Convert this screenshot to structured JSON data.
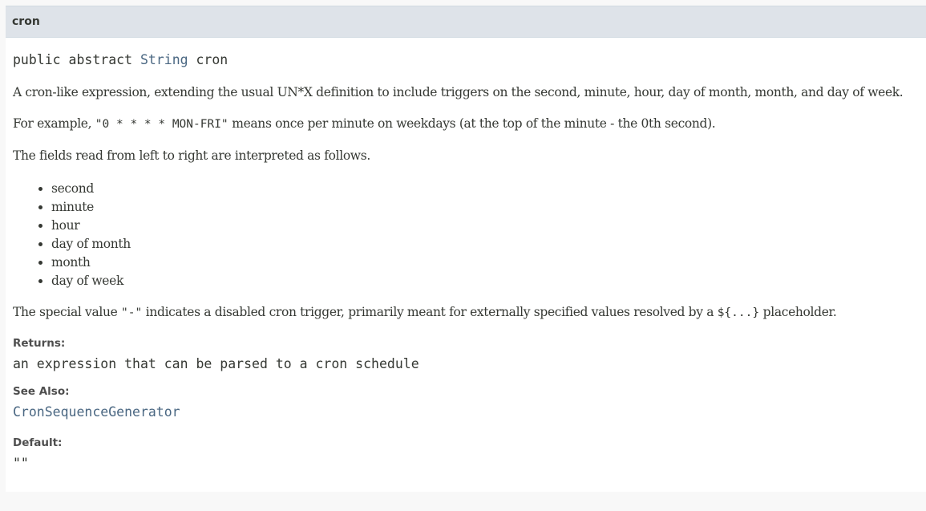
{
  "member": {
    "name": "cron"
  },
  "signature": {
    "modifiers": "public abstract ",
    "type": "String",
    "rest": " cron"
  },
  "description": {
    "intro": "A cron-like expression, extending the usual UN*X definition to include triggers on the second, minute, hour, day of month, month, and day of week.",
    "example_prefix": "For example, ",
    "example_code": "\"0 * * * * MON-FRI\"",
    "example_suffix": " means once per minute on weekdays (at the top of the minute - the 0th second).",
    "fields_intro": "The fields read from left to right are interpreted as follows.",
    "fields": [
      "second",
      "minute",
      "hour",
      "day of month",
      "month",
      "day of week"
    ],
    "special_prefix": "The special value ",
    "special_code": "\"-\"",
    "special_middle": " indicates a disabled cron trigger, primarily meant for externally specified values resolved by a ",
    "special_placeholder": "${...}",
    "special_suffix": " placeholder."
  },
  "returns": {
    "label": "Returns:",
    "value": "an expression that can be parsed to a cron schedule"
  },
  "see_also": {
    "label": "See Also:",
    "link": "CronSequenceGenerator"
  },
  "default": {
    "label": "Default:",
    "value": "\"\""
  },
  "colors": {
    "header_bg": "#dee3e9",
    "text": "#353833",
    "link": "#4a6782",
    "page_bg": "#f8f8f8"
  }
}
